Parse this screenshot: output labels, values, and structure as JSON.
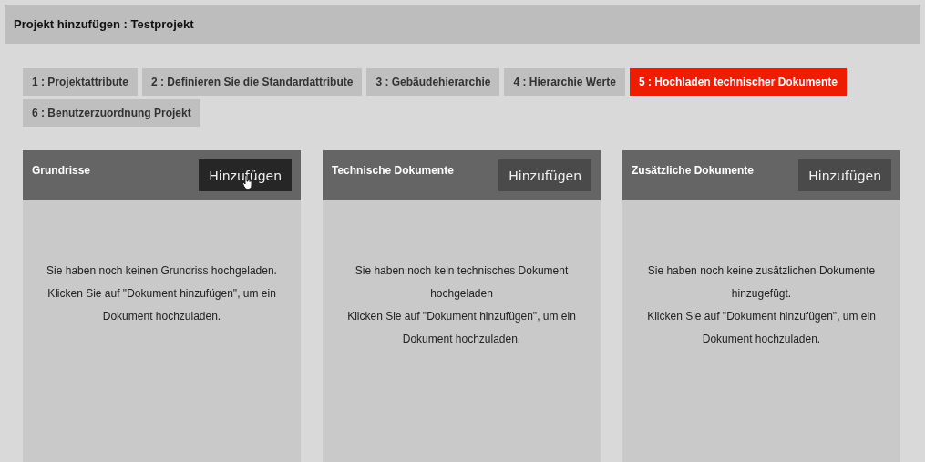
{
  "header": {
    "title": "Projekt hinzufügen : Testprojekt"
  },
  "tabs": [
    {
      "label": "1 : Projektattribute",
      "selected": false
    },
    {
      "label": "2 : Definieren Sie die Standardattribute",
      "selected": false
    },
    {
      "label": "3 : Gebäudehierarchie",
      "selected": false
    },
    {
      "label": "4 : Hierarchie Werte",
      "selected": false
    },
    {
      "label": "5 : Hochladen technischer Dokumente",
      "selected": true
    },
    {
      "label": "6 : Benutzerzuordnung Projekt",
      "selected": false
    }
  ],
  "panels": [
    {
      "title": "Grundrisse",
      "button": {
        "label": "Hinzufügen",
        "hovered": true
      },
      "message_lines": [
        "Sie haben noch keinen Grundriss hochgeladen.",
        "Klicken Sie auf \"Dokument hinzufügen\", um ein",
        "Dokument hochzuladen."
      ]
    },
    {
      "title": "Technische Dokumente",
      "button": {
        "label": "Hinzufügen",
        "hovered": false
      },
      "message_lines": [
        "Sie haben noch kein technisches Dokument",
        "hochgeladen",
        "Klicken Sie auf \"Dokument hinzufügen\", um ein",
        "Dokument hochzuladen."
      ]
    },
    {
      "title": "Zusätzliche Dokumente",
      "button": {
        "label": "Hinzufügen",
        "hovered": false
      },
      "message_lines": [
        "Sie haben noch keine zusätzlichen Dokumente",
        "hinzugefügt.",
        "Klicken Sie auf \"Dokument hinzufügen\", um ein",
        "Dokument hochzuladen."
      ]
    }
  ]
}
